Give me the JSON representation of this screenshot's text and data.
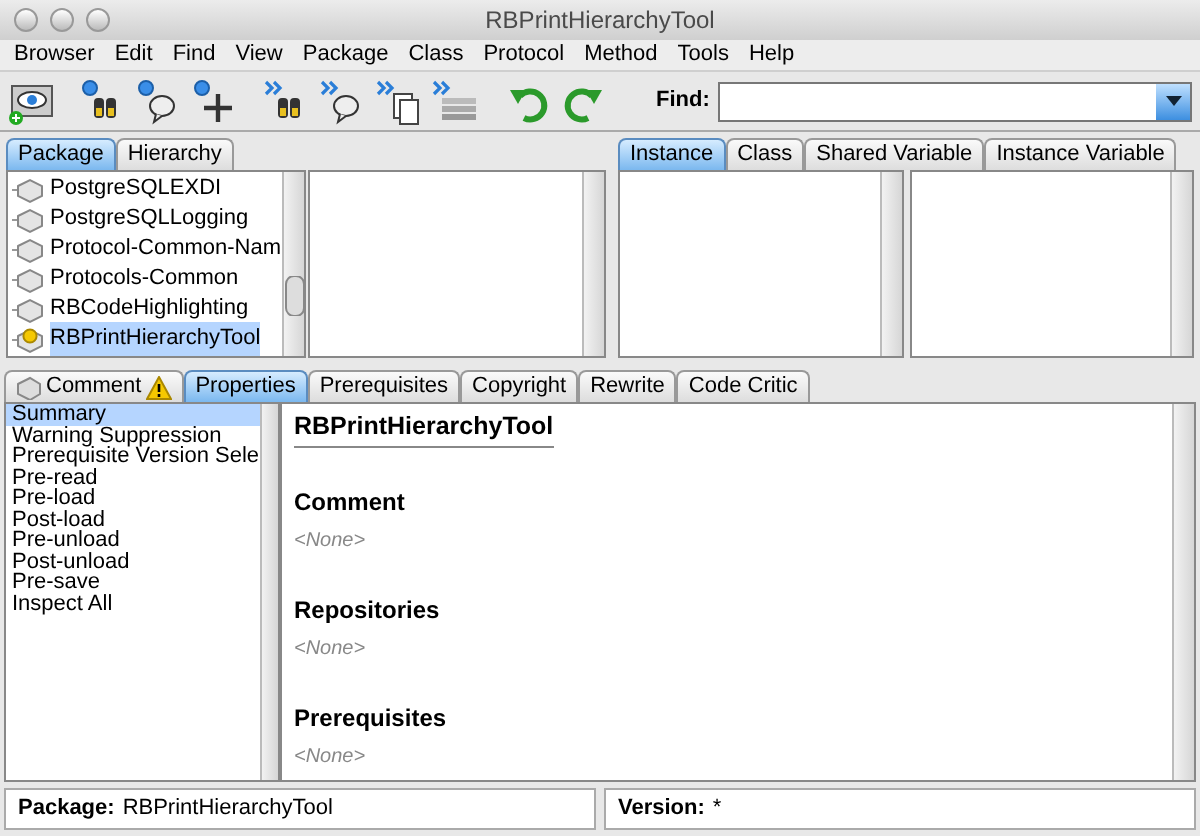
{
  "window": {
    "title": "RBPrintHierarchyTool"
  },
  "menu": [
    "Browser",
    "Edit",
    "Find",
    "View",
    "Package",
    "Class",
    "Protocol",
    "Method",
    "Tools",
    "Help"
  ],
  "toolbar": [
    {
      "kind": "browse"
    },
    {
      "kind": "find-class"
    },
    {
      "kind": "find-method"
    },
    {
      "kind": "add"
    },
    {
      "kind": "next-class"
    },
    {
      "kind": "next-method"
    },
    {
      "kind": "next-docs"
    },
    {
      "kind": "next-stack"
    },
    {
      "kind": "undo"
    },
    {
      "kind": "redo"
    }
  ],
  "find": {
    "label": "Find:"
  },
  "left_tabs": [
    {
      "label": "Package",
      "selected": true
    },
    {
      "label": "Hierarchy",
      "selected": false
    }
  ],
  "packages": [
    {
      "label": "PostgreSQLEXDI",
      "selected": false,
      "warning": false
    },
    {
      "label": "PostgreSQLLogging",
      "selected": false,
      "warning": false
    },
    {
      "label": "Protocol-Common-Nam",
      "selected": false,
      "warning": false
    },
    {
      "label": "Protocols-Common",
      "selected": false,
      "warning": false
    },
    {
      "label": "RBCodeHighlighting",
      "selected": false,
      "warning": false
    },
    {
      "label": "RBPrintHierarchyTool",
      "selected": true,
      "warning": true
    }
  ],
  "right_tabs": [
    {
      "label": "Instance",
      "selected": true
    },
    {
      "label": "Class",
      "selected": false
    },
    {
      "label": "Shared Variable",
      "selected": false
    },
    {
      "label": "Instance Variable",
      "selected": false
    }
  ],
  "bottom_tabs": [
    {
      "label": "Comment",
      "selected": false,
      "icon": true,
      "warning": true
    },
    {
      "label": "Properties",
      "selected": true,
      "icon": false,
      "warning": false
    },
    {
      "label": "Prerequisites",
      "selected": false,
      "icon": false,
      "warning": false
    },
    {
      "label": "Copyright",
      "selected": false,
      "icon": false,
      "warning": false
    },
    {
      "label": "Rewrite",
      "selected": false,
      "icon": false,
      "warning": false
    },
    {
      "label": "Code Critic",
      "selected": false,
      "icon": false,
      "warning": false
    }
  ],
  "properties": [
    {
      "label": "Summary",
      "selected": true
    },
    {
      "label": "Warning Suppression",
      "selected": false
    },
    {
      "label": "Prerequisite Version Sele",
      "selected": false
    },
    {
      "label": "Pre-read",
      "selected": false
    },
    {
      "label": "Pre-load",
      "selected": false
    },
    {
      "label": "Post-load",
      "selected": false
    },
    {
      "label": "Pre-unload",
      "selected": false
    },
    {
      "label": "Post-unload",
      "selected": false
    },
    {
      "label": "Pre-save",
      "selected": false
    },
    {
      "label": "Inspect All",
      "selected": false
    }
  ],
  "summary": {
    "title": "RBPrintHierarchyTool",
    "sections": [
      {
        "heading": "Comment",
        "value": "<None>"
      },
      {
        "heading": "Repositories",
        "value": "<None>"
      },
      {
        "heading": "Prerequisites",
        "value": "<None>"
      }
    ]
  },
  "status_bar": [
    {
      "label": "Package:",
      "value": "RBPrintHierarchyTool"
    },
    {
      "label": "Version:",
      "value": "*"
    }
  ]
}
